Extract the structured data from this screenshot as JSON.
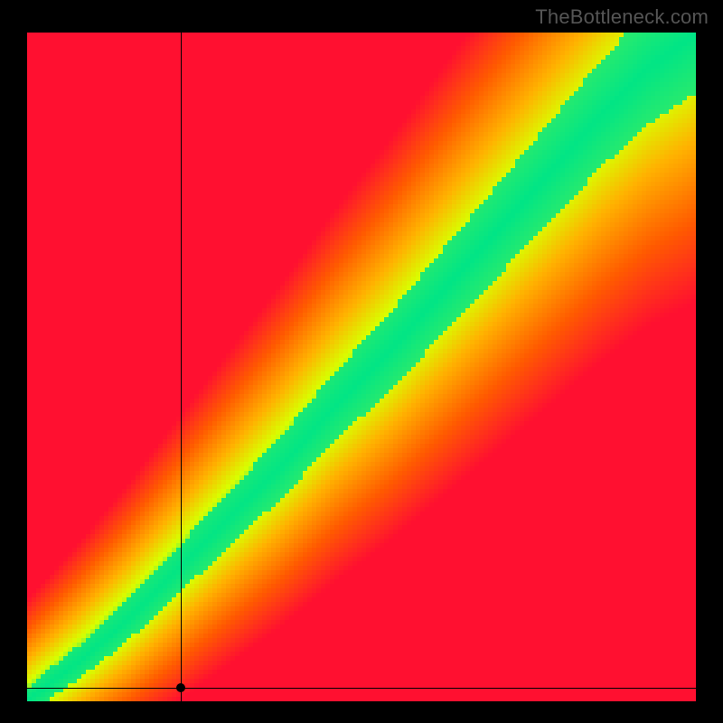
{
  "watermark": "TheBottleneck.com",
  "chart_data": {
    "type": "heatmap",
    "title": "",
    "xlabel": "",
    "ylabel": "",
    "xlim": [
      0,
      100
    ],
    "ylim": [
      0,
      100
    ],
    "grid": false,
    "description": "Continuous red→orange→yellow→green gradient field. Red dominates the upper-left and lower-right corners. A bright green diagonal band (optimal region) runs roughly from (0,0) to (100,100), slightly convex, bordered by yellow transition zones. Color encodes distance from the optimal diagonal.",
    "optimal_band": {
      "curve_points_xy": [
        [
          0,
          0
        ],
        [
          8,
          6
        ],
        [
          15,
          12
        ],
        [
          22,
          19
        ],
        [
          30,
          27
        ],
        [
          38,
          35
        ],
        [
          46,
          44
        ],
        [
          54,
          52
        ],
        [
          62,
          61
        ],
        [
          70,
          70
        ],
        [
          78,
          79
        ],
        [
          86,
          88
        ],
        [
          93,
          95
        ],
        [
          100,
          100
        ]
      ],
      "band_halfwidth_start": 2,
      "band_halfwidth_end": 9
    },
    "color_stops": [
      {
        "t": 0.0,
        "hex": "#00e586"
      },
      {
        "t": 0.18,
        "hex": "#d8ff00"
      },
      {
        "t": 0.4,
        "hex": "#ffb200"
      },
      {
        "t": 0.7,
        "hex": "#ff5a00"
      },
      {
        "t": 1.0,
        "hex": "#ff1030"
      }
    ],
    "crosshair": {
      "x": 23,
      "y": 2
    },
    "marker": {
      "x": 23,
      "y": 2
    }
  }
}
